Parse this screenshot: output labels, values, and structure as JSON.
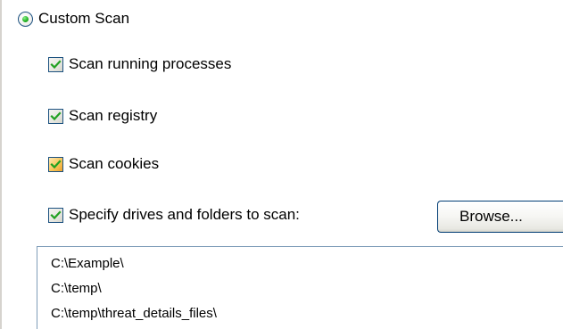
{
  "custom_scan": {
    "label": "Custom Scan",
    "selected": true
  },
  "options": [
    {
      "label": "Scan running processes",
      "checked": true
    },
    {
      "label": "Scan registry",
      "checked": true
    },
    {
      "label": "Scan cookies",
      "checked": true
    },
    {
      "label": "Specify drives and folders to scan:",
      "checked": true
    }
  ],
  "browse_button": {
    "label": "Browse..."
  },
  "folders": [
    "C:\\Example\\",
    "C:\\temp\\",
    "C:\\temp\\threat_details_files\\"
  ],
  "colors": {
    "check_mark": "#21a121",
    "radio_dot": "#28b428",
    "border": "#1c5180",
    "list_border": "#7f9db9"
  }
}
